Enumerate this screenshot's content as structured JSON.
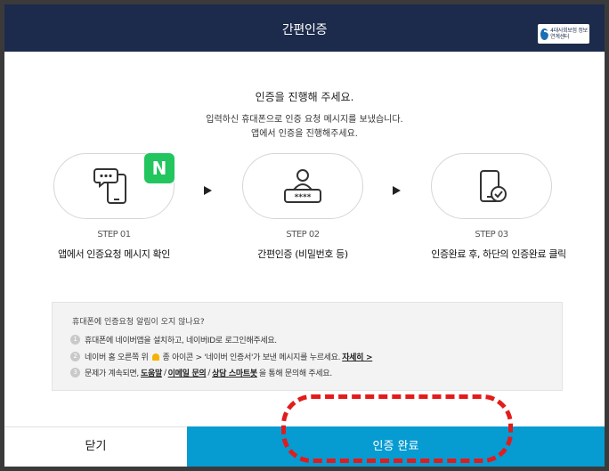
{
  "header": {
    "title": "간편인증",
    "logo_text": "4대사회보험 정보연계센터"
  },
  "intro": {
    "line1": "인증을 진행해 주세요.",
    "line2": "입력하신 휴대폰으로 인증 요청 메시지를 보냈습니다.",
    "line3": "앱에서 인증을 진행해주세요."
  },
  "steps": [
    {
      "label": "STEP 01",
      "desc": "앱에서 인증요청 메시지 확인",
      "icon": "phone-chat-icon"
    },
    {
      "label": "STEP 02",
      "desc": "간편인증 (비밀번호 등)",
      "icon": "user-password-icon"
    },
    {
      "label": "STEP 03",
      "desc": "인증완료 후, 하단의 인증완료 클릭",
      "icon": "phone-check-icon"
    }
  ],
  "naver_badge": "N",
  "notice": {
    "question": "휴대폰에 인증요청 알림이 오지 않나요?",
    "items": [
      {
        "num": "1",
        "text": "휴대폰에 네이버앱을 설치하고, 네이버ID로 로그인해주세요."
      },
      {
        "num": "2",
        "text_a": "네이버 홈 오른쪽 위",
        "text_b": "종 아이콘 > '네이버 인증서'가 보낸 메시지를 누르세요.",
        "link": "자세히 >"
      },
      {
        "num": "3",
        "text_a": "문제가 계속되면,",
        "link1": "도움말",
        "sep1": "/",
        "link2": "이메일 문의",
        "sep2": "/",
        "link3": "상담 스마트봇",
        "text_b": "을 통해 문의해 주세요."
      }
    ]
  },
  "footer": {
    "close_label": "닫기",
    "complete_label": "인증 완료"
  },
  "colors": {
    "header_bg": "#1c2b4b",
    "primary": "#069bd1",
    "naver_green": "#22c55e",
    "annotation": "#e31b1b"
  }
}
